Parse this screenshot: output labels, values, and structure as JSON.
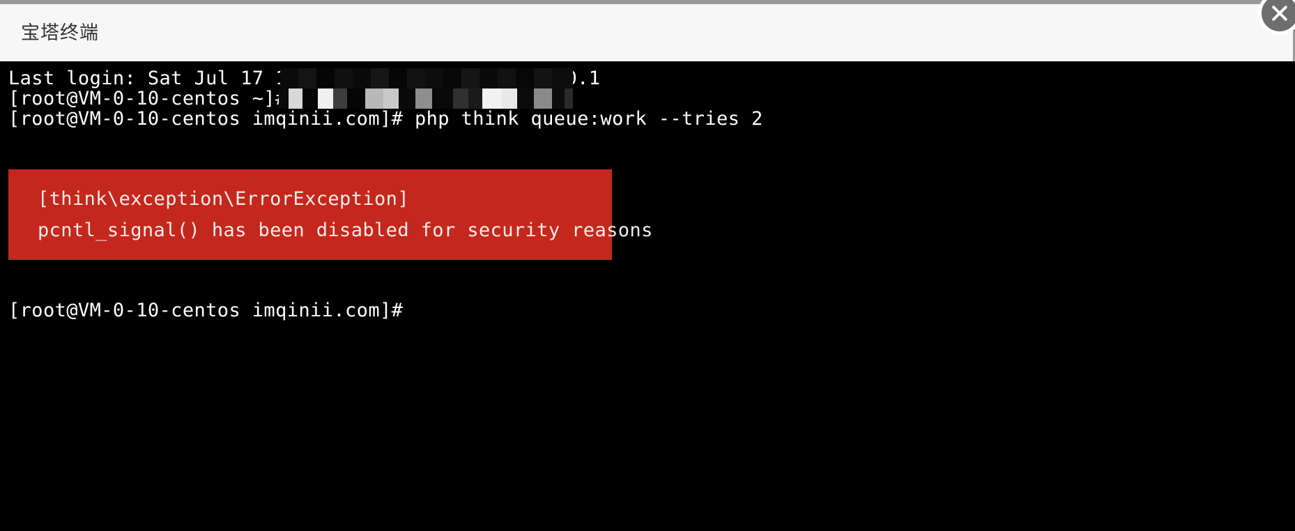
{
  "window": {
    "title": "宝塔终端",
    "close_icon": "close-icon",
    "close_label": "×"
  },
  "terminal": {
    "background": "#000000",
    "foreground": "#ffffff",
    "lines": [
      {
        "type": "text",
        "text": "Last login: Sat Jul 17 11:05:13 2021 from 127.0.0.1",
        "censored": true
      },
      {
        "type": "text",
        "text": "[root@VM-0-10-centos ~]# ",
        "censored": true
      },
      {
        "type": "text",
        "text": "[root@VM-0-10-centos imqinii.com]# php think queue:work --tries 2",
        "censored": false
      }
    ],
    "line_login": "Last login: Sat Jul 17 11:05:13 2021 from 127.0.0.1",
    "line_prompt_home": "[root@VM-0-10-centos ~]# ",
    "line_command": "[root@VM-0-10-centos imqinii.com]# php think queue:work --tries 2",
    "line_final_prompt": "[root@VM-0-10-centos imqinii.com]#"
  },
  "error": {
    "background": "#c4281c",
    "foreground": "#f2ecec",
    "exception_class": "[think\\exception\\ErrorException]",
    "message": "pcntl_signal() has been disabled for security reasons"
  }
}
